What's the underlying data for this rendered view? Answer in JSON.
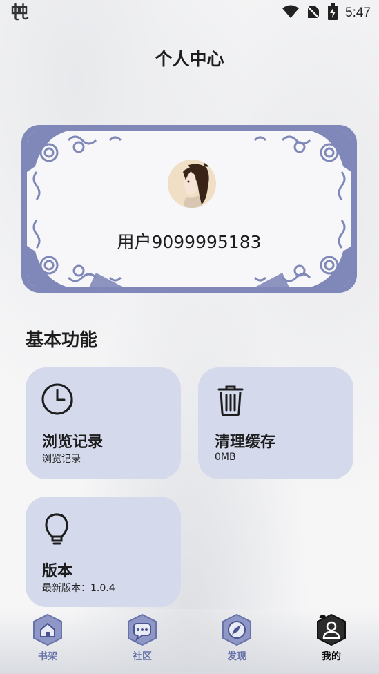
{
  "status_bar": {
    "app_icon": "chong-glyph-icon",
    "time": "5:47",
    "icons": [
      "wifi-icon",
      "no-sim-icon",
      "battery-charging-icon"
    ]
  },
  "header": {
    "title": "个人中心"
  },
  "profile": {
    "username": "用户9099995183",
    "frame_color": "#7f88b8"
  },
  "basic_functions": {
    "title": "基本功能",
    "tiles": [
      {
        "icon": "clock-icon",
        "title": "浏览记录",
        "subtitle": "浏览记录"
      },
      {
        "icon": "trash-icon",
        "title": "清理缓存",
        "subtitle": "0MB"
      },
      {
        "icon": "lightbulb-icon",
        "title": "版本",
        "subtitle": "最新版本：1.0.4"
      }
    ],
    "tile_color": "#d5d9ec"
  },
  "bottom_nav": {
    "items": [
      {
        "label": "书架",
        "icon": "home-icon",
        "active": false
      },
      {
        "label": "社区",
        "icon": "chat-icon",
        "active": false
      },
      {
        "label": "发现",
        "icon": "compass-icon",
        "active": false
      },
      {
        "label": "我的",
        "icon": "user-icon",
        "active": true
      }
    ],
    "accent": "#6873aa",
    "active_color": "#111111"
  }
}
